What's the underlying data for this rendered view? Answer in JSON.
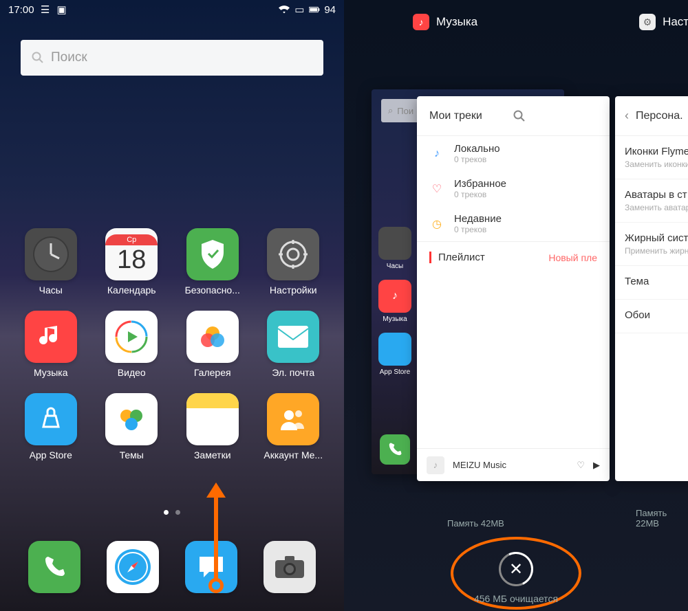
{
  "status": {
    "time": "17:00",
    "battery": "94"
  },
  "search": {
    "placeholder": "Поиск"
  },
  "apps": {
    "row1": [
      {
        "key": "clock",
        "label": "Часы"
      },
      {
        "key": "calendar",
        "label": "Календарь",
        "weekday": "Ср",
        "day": "18"
      },
      {
        "key": "security",
        "label": "Безопасно..."
      },
      {
        "key": "settings",
        "label": "Настройки"
      }
    ],
    "row2": [
      {
        "key": "music",
        "label": "Музыка"
      },
      {
        "key": "video",
        "label": "Видео"
      },
      {
        "key": "gallery",
        "label": "Галерея"
      },
      {
        "key": "mail",
        "label": "Эл. почта"
      }
    ],
    "row3": [
      {
        "key": "appstore",
        "label": "App Store"
      },
      {
        "key": "themes",
        "label": "Темы"
      },
      {
        "key": "notes",
        "label": "Заметки"
      },
      {
        "key": "account",
        "label": "Аккаунт Me..."
      }
    ]
  },
  "dock": [
    "phone",
    "safari",
    "messages",
    "camera"
  ],
  "recents": {
    "apps": [
      {
        "title": "Музыка",
        "mem": "Память 42MB"
      },
      {
        "title": "Настро",
        "mem": "Память 22MB"
      }
    ],
    "clearing": "456 МБ очищается"
  },
  "music_card": {
    "title": "Мои треки",
    "items": [
      {
        "icon": "music",
        "label": "Локально",
        "sub": "0 треков",
        "color": "#4aa0ff"
      },
      {
        "icon": "heart",
        "label": "Избранное",
        "sub": "0 треков",
        "color": "#ff5566"
      },
      {
        "icon": "clock",
        "label": "Недавние",
        "sub": "0 треков",
        "color": "#ffb020"
      }
    ],
    "playlist_label": "Плейлист",
    "playlist_action": "Новый пле",
    "nowplaying": "MEIZU Music"
  },
  "settings_card": {
    "back_label": "Персона.",
    "rows": [
      {
        "t1": "Иконки Flyme",
        "t2": "Заменить иконки стиле Flyme"
      },
      {
        "t1": "Аватары в ст",
        "t2": "Заменить аватар стиле Flyme"
      },
      {
        "t1": "Жирный сист",
        "t2": "Применить жирн"
      },
      {
        "t1": "Тема",
        "t2": ""
      },
      {
        "t1": "Обои",
        "t2": ""
      }
    ]
  },
  "mini_home": {
    "search": "Пои",
    "labels": [
      "Часы",
      "Музыка",
      "App Store"
    ]
  }
}
